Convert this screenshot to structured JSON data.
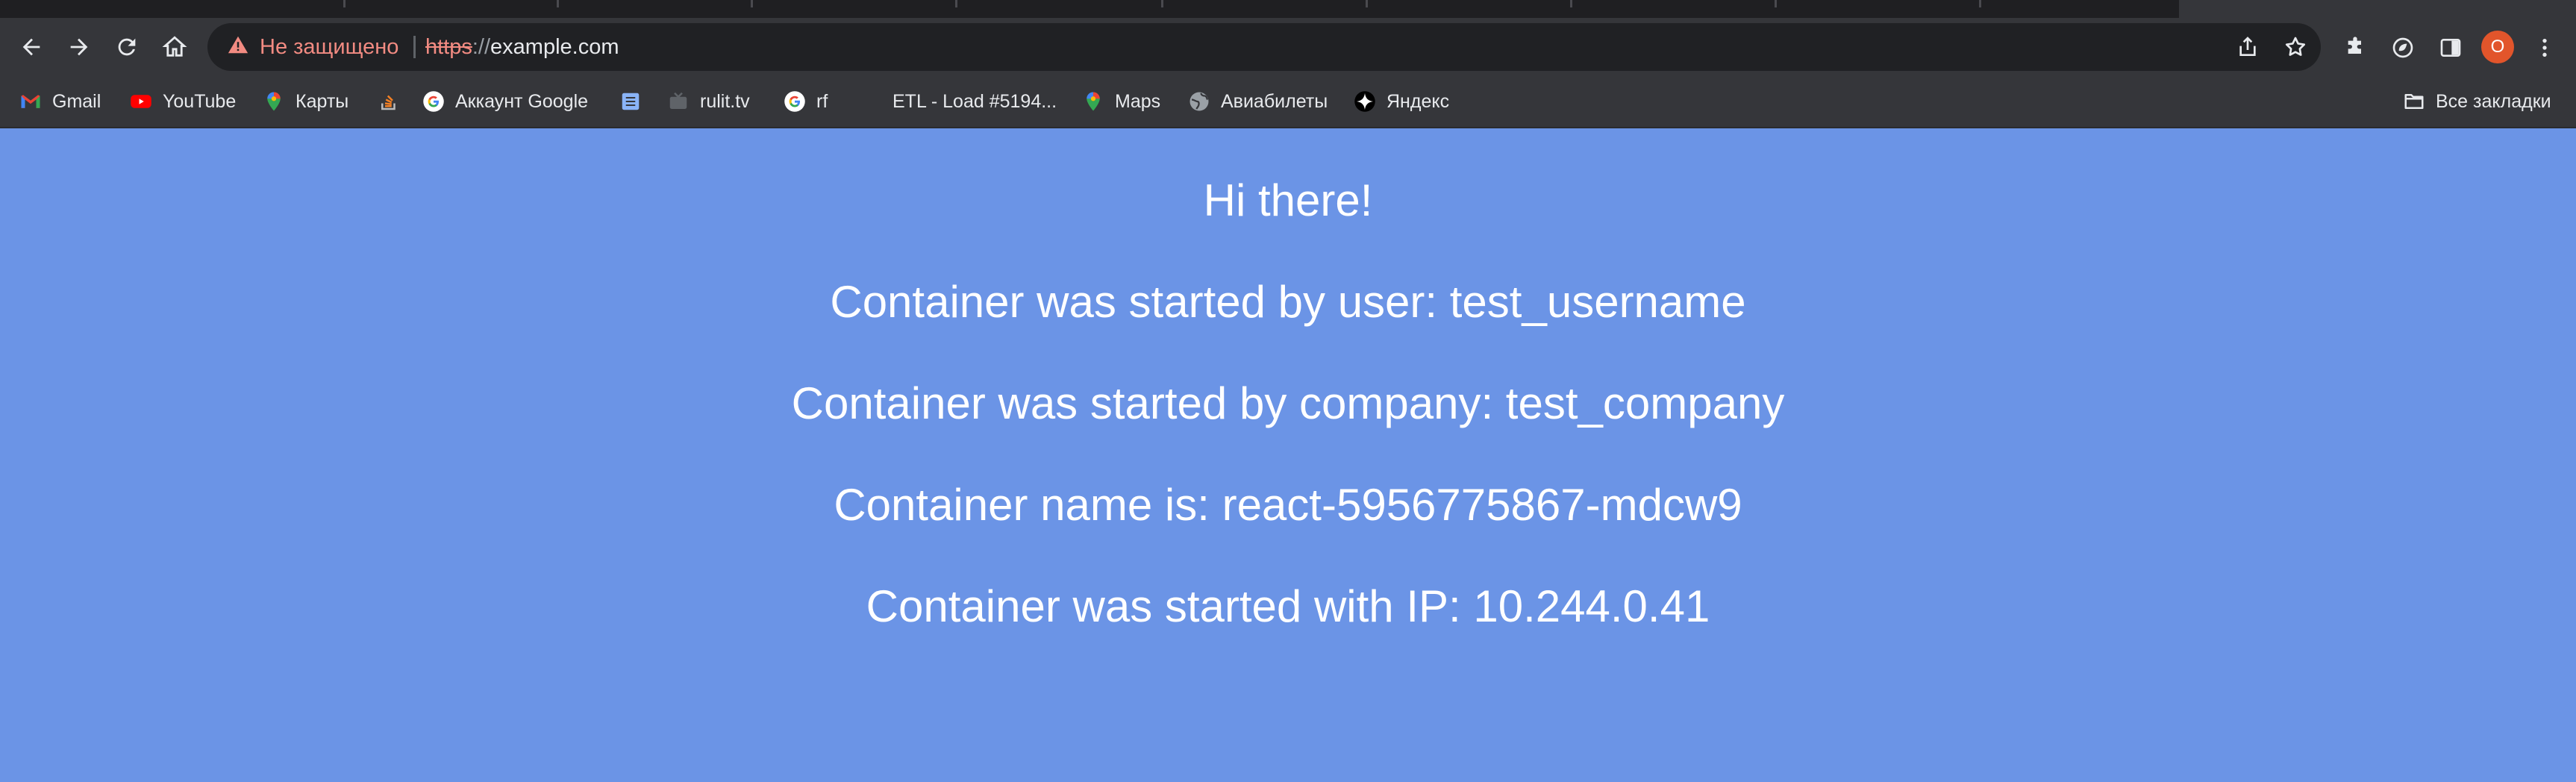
{
  "browser": {
    "omnibox": {
      "security_warning": "Не защищено",
      "url_scheme": "https",
      "url_separator": "://",
      "url_host": "example.com"
    },
    "profile_initial": "O",
    "colors": {
      "accent_warning": "#f28b82",
      "avatar": "#e2552b",
      "toolbar": "#35363a",
      "omnibox": "#202124"
    },
    "bookmarks": [
      {
        "label": "Gmail",
        "icon": "gmail-icon"
      },
      {
        "label": "YouTube",
        "icon": "youtube-icon"
      },
      {
        "label": "Карты",
        "icon": "maps-pin-icon"
      },
      {
        "label": "",
        "icon": "stackoverflow-icon"
      },
      {
        "label": "Аккаунт Google",
        "icon": "google-icon"
      },
      {
        "label": "",
        "icon": "document-icon"
      },
      {
        "label": "rulit.tv",
        "icon": "tv-icon"
      },
      {
        "label": "rf",
        "icon": "google-icon"
      },
      {
        "label": "ETL - Load #5194...",
        "icon": ""
      },
      {
        "label": "Maps",
        "icon": "maps-pin-icon"
      },
      {
        "label": "Авиабилеты",
        "icon": "globe-icon"
      },
      {
        "label": "Яндекс",
        "icon": "yandex-star-icon"
      }
    ],
    "all_bookmarks_label": "Все закладки"
  },
  "page": {
    "background_color": "#6b94e6",
    "lines": [
      "Hi there!",
      "Container was started by user: test_username",
      "Container was started by company: test_company",
      "Container name is: react-5956775867-mdcw9",
      "Container was started with IP: 10.244.0.41"
    ]
  }
}
